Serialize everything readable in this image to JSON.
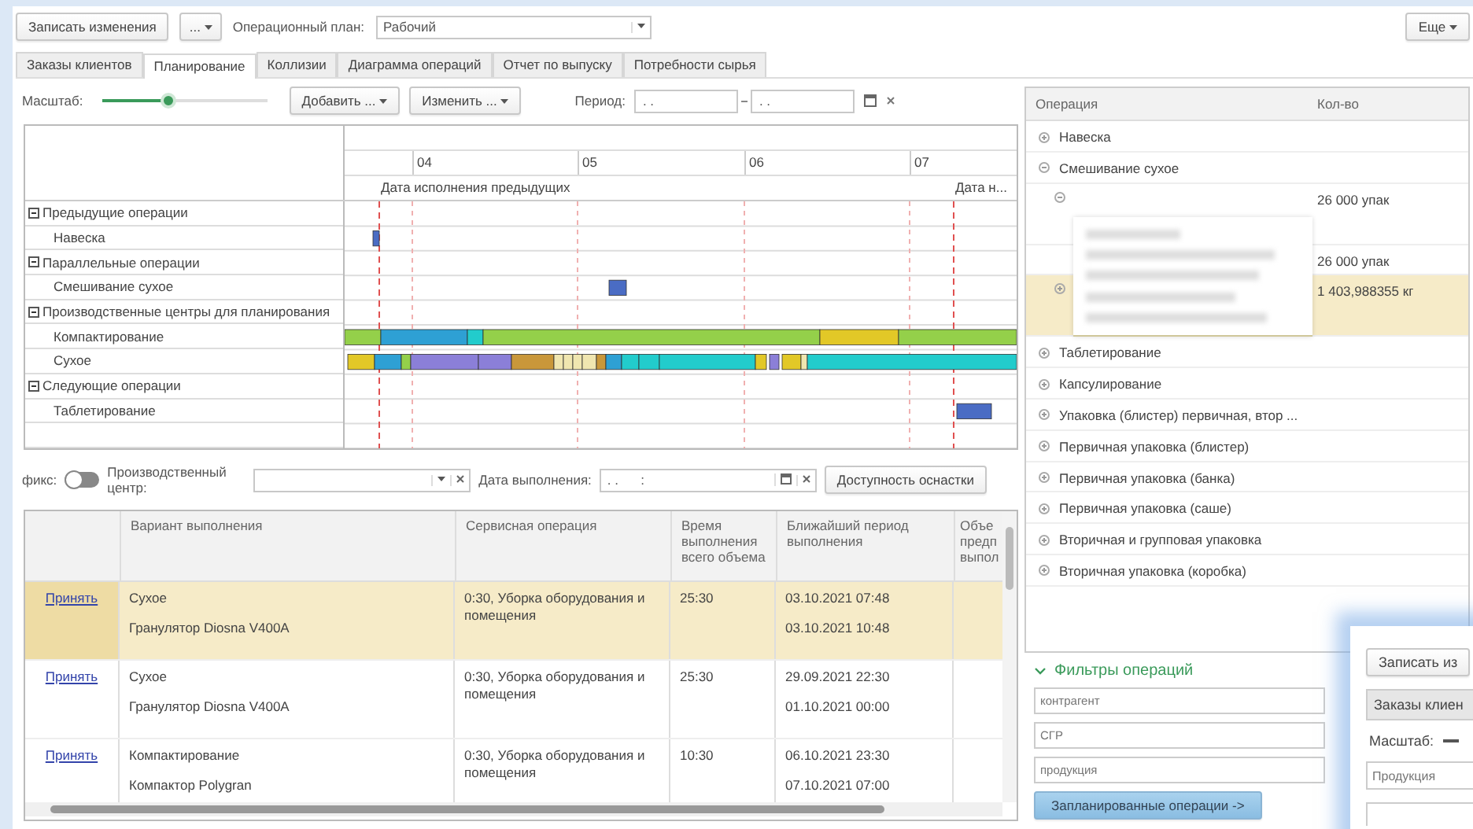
{
  "toolbar": {
    "save_button": "Записать изменения",
    "more_button": "...",
    "plan_label": "Операционный план:",
    "plan_value": "Рабочий",
    "more_menu": "Еще"
  },
  "tabs": [
    {
      "label": "Заказы клиентов",
      "selected": false
    },
    {
      "label": "Планирование",
      "selected": true
    },
    {
      "label": "Коллизии",
      "selected": false
    },
    {
      "label": "Диаграмма операций",
      "selected": false
    },
    {
      "label": "Отчет по выпуску",
      "selected": false
    },
    {
      "label": "Потребности сырья",
      "selected": false
    }
  ],
  "planning_toolbar": {
    "scale_label": "Масштаб:",
    "scale": {
      "level": 0.4
    },
    "add_button": "Добавить ...",
    "change_button": "Изменить ...",
    "period_label": "Период:",
    "period_from": ". .",
    "period_to": ". ."
  },
  "gantt": {
    "days": [
      "04",
      "05",
      "06",
      "07"
    ],
    "markers": [
      "Дата исполнения предыдущих",
      "Дата н..."
    ],
    "groups": [
      {
        "label": "Предыдущие операции",
        "expanded": true,
        "children": [
          {
            "label": "Навеска"
          }
        ]
      },
      {
        "label": "Параллельные операции",
        "expanded": true,
        "children": [
          {
            "label": "Смешивание сухое"
          }
        ]
      },
      {
        "label": "Производственные центры для планирования",
        "expanded": true,
        "children": [
          {
            "label": "Компактирование"
          },
          {
            "label": "Сухое"
          }
        ]
      },
      {
        "label": "Следующие операции",
        "expanded": true,
        "children": [
          {
            "label": "Таблетирование"
          }
        ]
      }
    ]
  },
  "filter_row": {
    "fix_label": "фикс:",
    "fix_on": false,
    "center_label": "Производственный центр:",
    "date_label": "Дата выполнения:",
    "date_value": ". .      :",
    "tooling_button": "Доступность оснастки"
  },
  "variants_table": {
    "columns": [
      "Вариант выполнения",
      "Сервисная операция",
      "Время выполнения всего объема",
      "Ближайший период выполнения",
      "Объе предп выпол"
    ],
    "rows": [
      {
        "action": "Принять",
        "variant": "Сухое",
        "equipment": "Гранулятор Diosna V400A",
        "service": "0:30, Уборка оборудования и помещения",
        "time": "25:30",
        "period_start": "03.10.2021  07:48",
        "period_end": "03.10.2021  10:48",
        "selected": true
      },
      {
        "action": "Принять",
        "variant": "Сухое",
        "equipment": "Гранулятор Diosna V400A",
        "service": "0:30, Уборка оборудования и помещения",
        "time": "25:30",
        "period_start": "29.09.2021  22:30",
        "period_end": "01.10.2021  00:00",
        "selected": false
      },
      {
        "action": "Принять",
        "variant": "Компактирование",
        "equipment": "Компактор Polygran",
        "service": "0:30, Уборка оборудования и помещения",
        "time": "10:30",
        "period_start": "06.10.2021  23:30",
        "period_end": "07.10.2021  07:00",
        "selected": false
      }
    ]
  },
  "operations_tree": {
    "columns": [
      "Операция",
      "Кол-во"
    ],
    "items": [
      {
        "label": "Навеска",
        "expanded": false,
        "selected": false
      },
      {
        "label": "Смешивание сухое",
        "expanded": true,
        "selected": false,
        "children": [
          {
            "qty": "26 000 упак",
            "expanded": true,
            "selected": false,
            "children": [
              {
                "qty": "26 000 упак",
                "selected": false
              }
            ]
          },
          {
            "qty": "1 403,988355 кг",
            "expanded": false,
            "selected": true
          }
        ]
      },
      {
        "label": "Таблетирование",
        "expanded": false,
        "selected": false
      },
      {
        "label": "Капсулирование",
        "expanded": false,
        "selected": false
      },
      {
        "label": "Упаковка (блистер) первичная, втор ...",
        "expanded": false,
        "selected": false
      },
      {
        "label": "Первичная упаковка (блистер)",
        "expanded": false,
        "selected": false
      },
      {
        "label": "Первичная упаковка (банка)",
        "expanded": false,
        "selected": false
      },
      {
        "label": "Первичная упаковка (саше)",
        "expanded": false,
        "selected": false
      },
      {
        "label": "Вторичная и групповая упаковка",
        "expanded": false,
        "selected": false
      },
      {
        "label": "Вторичная упаковка (коробка)",
        "expanded": false,
        "selected": false
      }
    ]
  },
  "operation_filters": {
    "title": "Фильтры операций",
    "expanded": true,
    "placeholders": [
      "контрагент",
      "СГР",
      "продукция"
    ],
    "button": "Запланированные операции ->"
  },
  "second_window": {
    "save_button": "Записать из",
    "tab": "Заказы клиен",
    "scale_label": "Масштаб:",
    "product_placeholder": "Продукция"
  }
}
